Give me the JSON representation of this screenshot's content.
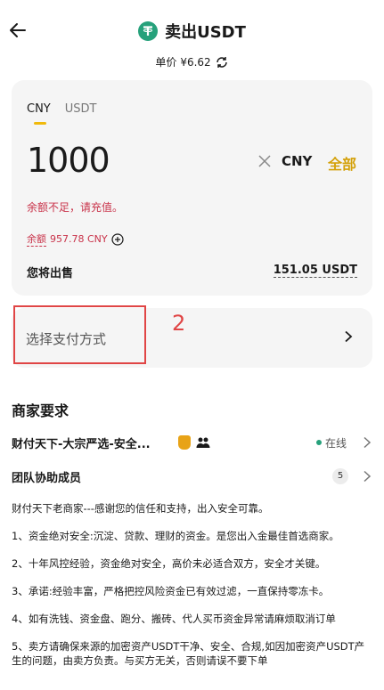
{
  "header": {
    "title": "卖出USDT",
    "price_label": "单价",
    "price_value": "¥6.62",
    "logo_icon": "tether-icon"
  },
  "form": {
    "tabs": [
      "CNY",
      "USDT"
    ],
    "active_tab": "CNY",
    "amount": "1000",
    "currency": "CNY",
    "all_button": "全部",
    "error": "余额不足，请充值。",
    "balance_label": "余额",
    "balance_value": "957.78 CNY",
    "sell_label": "您将出售",
    "sell_value": "151.05 USDT"
  },
  "payment": {
    "label": "选择支付方式",
    "annotation_number": "2"
  },
  "merchant_section": {
    "title": "商家要求",
    "merchant_name": "财付天下-大宗严选-安全...",
    "status": "在线",
    "team_label": "团队协助成员",
    "team_count": "5"
  },
  "description": [
    "财付天下老商家---感谢您的信任和支持，出入安全可靠。",
    "1、资金绝对安全:沉淀、贷款、理财的资金。是您出入金最佳首选商家。",
    "2、十年风控经验，资金绝对安全，高价未必适合双方，安全才关键。",
    "3、承诺:经验丰富，严格把控风险资金已有效过滤，一直保持零冻卡。",
    "4、如有洗钱、资金盘、跑分、搬砖、代人买币资金异常请麻烦取消订单",
    "5、卖方请确保来源的加密资产USDT干净、安全、合规,如因加密资产USDT产生的问题，由卖方负责。与买方无关，否则请误不要下单"
  ],
  "colors": {
    "accent": "#f0b90b",
    "error": "#c9334a",
    "online": "#26a17b",
    "annotation": "#e04545"
  }
}
